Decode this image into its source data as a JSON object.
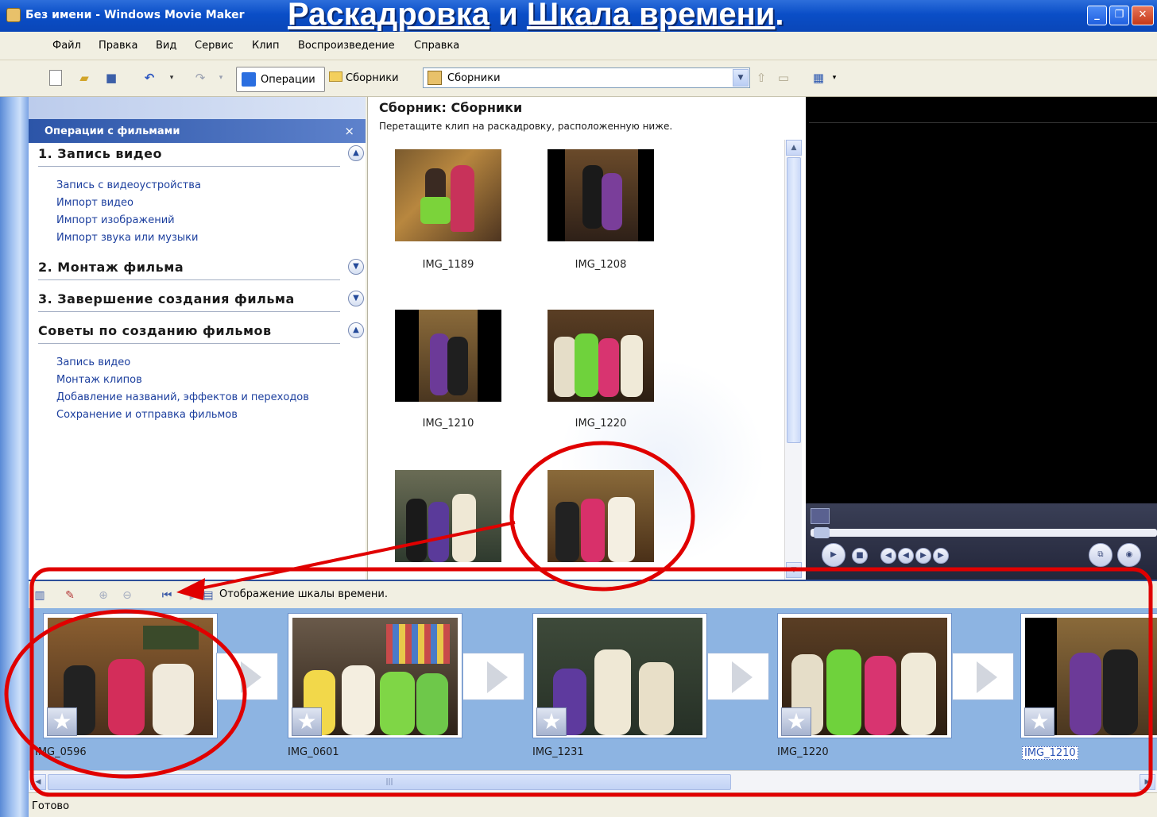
{
  "window": {
    "title": "Без имени - Windows Movie Maker",
    "slide_title_part1": "Раскадровка",
    "slide_title_and": " и ",
    "slide_title_part2": "Шкала времени",
    "slide_title_dot": "."
  },
  "menu": [
    "Файл",
    "Правка",
    "Вид",
    "Сервис",
    "Клип",
    "Воспроизведение",
    "Справка"
  ],
  "toolbar": {
    "operations_label": "Операции",
    "collections_label": "Сборники",
    "collection_select_value": "Сборники"
  },
  "tasks": {
    "header": "Операции с фильмами",
    "close_glyph": "×",
    "sections": [
      {
        "title": "1. Запись видео",
        "expanded": true,
        "links": [
          "Запись с видеоустройства",
          "Импорт видео",
          "Импорт изображений",
          "Импорт звука или музыки"
        ]
      },
      {
        "title": "2. Монтаж фильма",
        "expanded": false,
        "links": []
      },
      {
        "title": "3. Завершение создания фильма",
        "expanded": false,
        "links": []
      },
      {
        "title": "Советы по созданию фильмов",
        "expanded": true,
        "links": [
          "Запись видео",
          "Монтаж клипов",
          "Добавление названий, эффектов и переходов",
          "Сохранение и отправка фильмов"
        ]
      }
    ]
  },
  "collection": {
    "title": "Сборник: Сборники",
    "subtitle": "Перетащите клип на раскадровку, расположенную ниже.",
    "clips": [
      "IMG_1189",
      "IMG_1208",
      "IMG_1210",
      "IMG_1220",
      "",
      ""
    ]
  },
  "storyboard": {
    "toolbar_label": "Отображение шкалы времени.",
    "clips": [
      "IMG_0596",
      "IMG_0601",
      "IMG_1231",
      "IMG_1220",
      "IMG_1210"
    ],
    "selected_clip": "IMG_1210"
  },
  "status": {
    "text": "Готово"
  },
  "colors": {
    "title_bar": "#0a4ec7",
    "storyboard_bg": "#8db4e2",
    "annotation": "#e00000"
  },
  "icons": [
    "new-project-icon",
    "open-icon",
    "save-icon",
    "undo-icon",
    "redo-icon",
    "operations-icon",
    "collections-folder-icon",
    "up-folder-icon",
    "new-folder-icon",
    "views-icon",
    "play-icon",
    "stop-icon",
    "star-effect-icon"
  ]
}
